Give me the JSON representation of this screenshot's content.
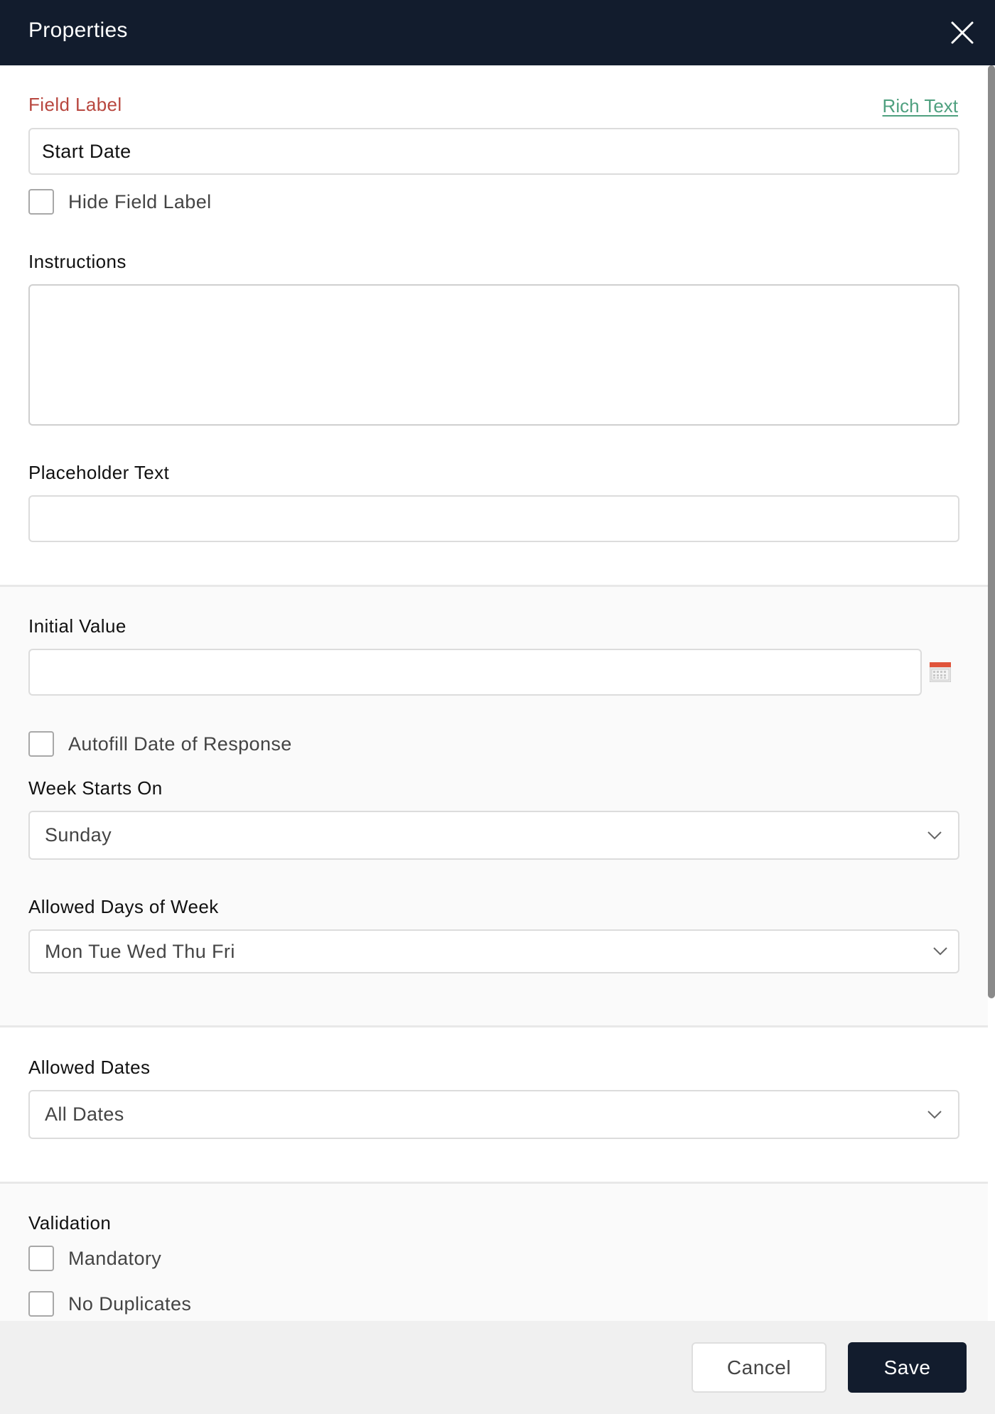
{
  "header": {
    "title": "Properties",
    "close_icon": "close-icon"
  },
  "field_label": {
    "label": "Field Label",
    "rich_text_link": "Rich Text",
    "value": "Start Date",
    "hide_label_checkbox": {
      "label": "Hide Field Label",
      "checked": false
    }
  },
  "instructions": {
    "label": "Instructions",
    "value": ""
  },
  "placeholder_text": {
    "label": "Placeholder Text",
    "value": ""
  },
  "initial_value": {
    "label": "Initial Value",
    "value": "",
    "calendar_icon": "calendar-icon"
  },
  "autofill": {
    "label": "Autofill Date of Response",
    "checked": false
  },
  "week_starts_on": {
    "label": "Week Starts On",
    "selected": "Sunday"
  },
  "allowed_days": {
    "label": "Allowed Days of Week",
    "selected": "Mon Tue Wed Thu Fri"
  },
  "allowed_dates": {
    "label": "Allowed Dates",
    "selected": "All Dates"
  },
  "validation": {
    "label": "Validation",
    "options": [
      {
        "label": "Mandatory",
        "checked": false
      },
      {
        "label": "No Duplicates",
        "checked": false
      }
    ]
  },
  "footer": {
    "cancel_label": "Cancel",
    "save_label": "Save"
  },
  "colors": {
    "header_bg": "#121c2d",
    "required_label": "#b8473f",
    "link": "#4fa07f",
    "calendar_accent": "#e0533a",
    "save_bg": "#121c2d"
  }
}
